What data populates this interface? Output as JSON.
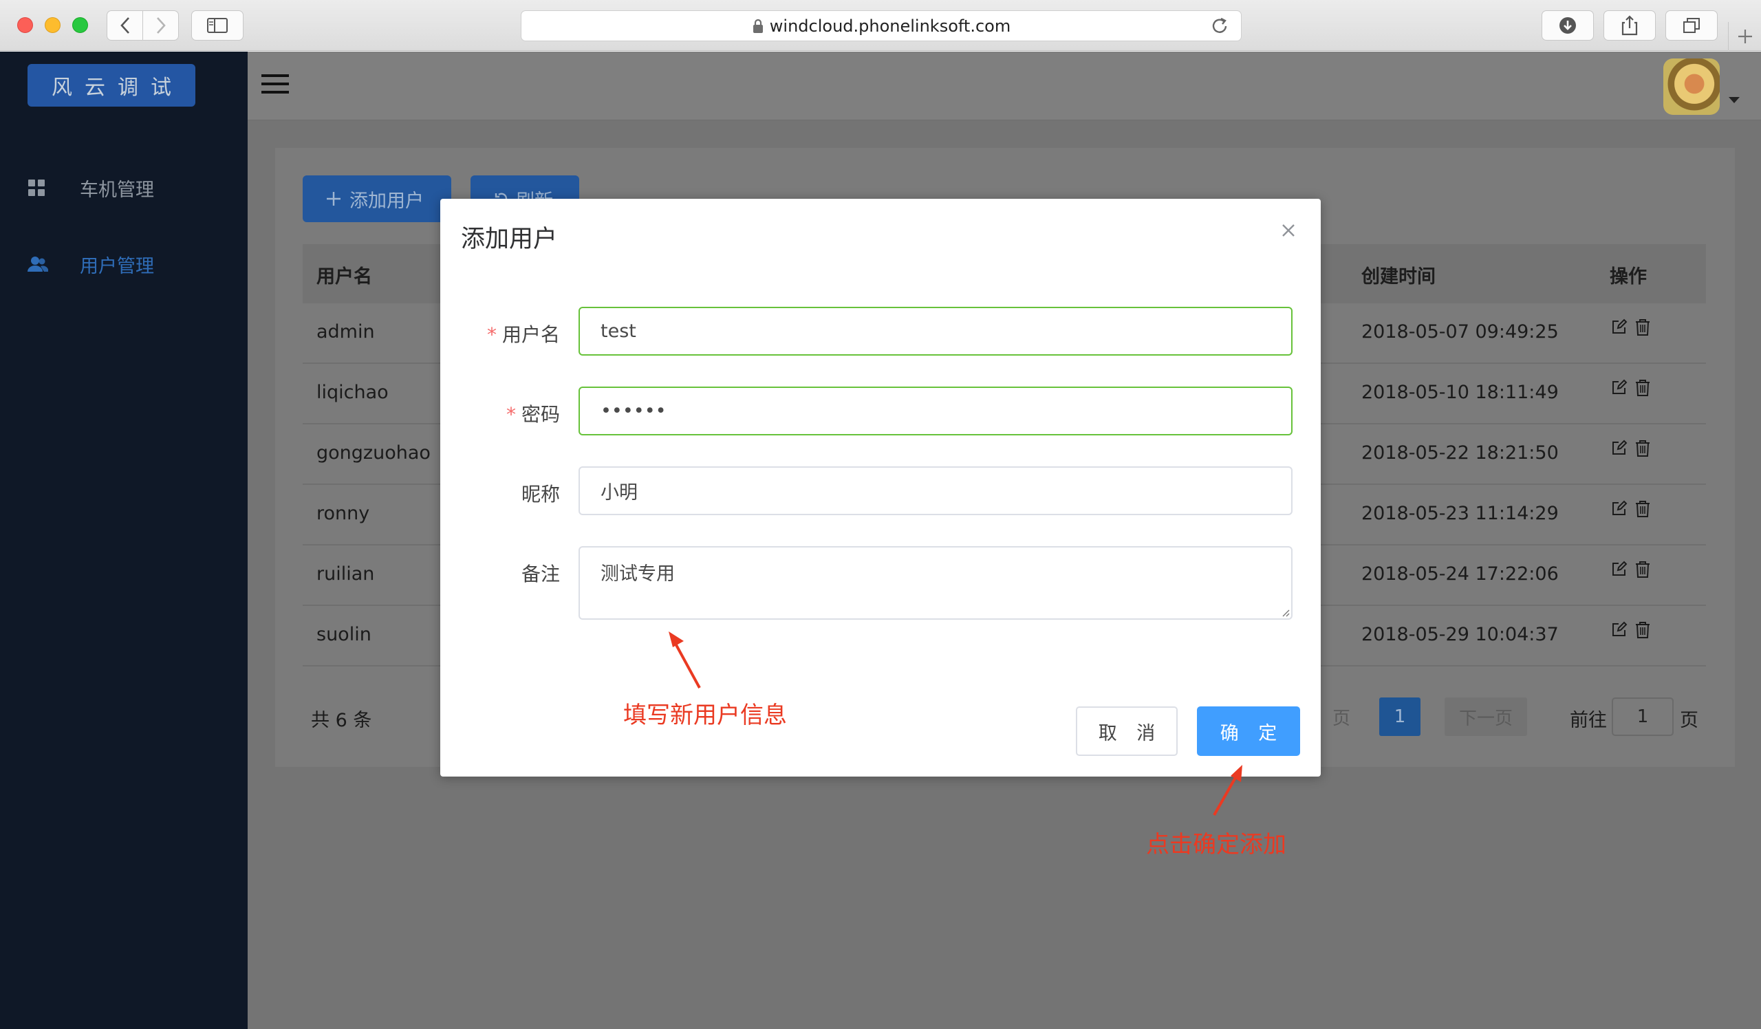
{
  "browser": {
    "url": "windcloud.phonelinksoft.com"
  },
  "sidebar": {
    "logo": "风云调试",
    "items": [
      {
        "label": "车机管理",
        "icon": "grid-icon",
        "active": false
      },
      {
        "label": "用户管理",
        "icon": "users-icon",
        "active": true
      }
    ]
  },
  "toolbar": {
    "add_user": "添加用户",
    "refresh": "刷新"
  },
  "table": {
    "columns": [
      "用户名",
      "创建时间",
      "操作"
    ],
    "rows": [
      {
        "username": "admin",
        "created": "2018-05-07 09:49:25"
      },
      {
        "username": "liqichao",
        "created": "2018-05-10 18:11:49"
      },
      {
        "username": "gongzuohao",
        "created": "2018-05-22 18:21:50"
      },
      {
        "username": "ronny",
        "created": "2018-05-23 11:14:29"
      },
      {
        "username": "ruilian",
        "created": "2018-05-24 17:22:06"
      },
      {
        "username": "suolin",
        "created": "2018-05-29 10:04:37"
      }
    ]
  },
  "pagination": {
    "total": "共 6 条",
    "prev": "页",
    "current": "1",
    "next": "下一页",
    "goto_label": "前往",
    "goto_value": "1",
    "page_suffix": "页"
  },
  "modal": {
    "title": "添加用户",
    "fields": {
      "username": {
        "label": "用户名",
        "value": "test",
        "required": true
      },
      "password": {
        "label": "密码",
        "value": "••••••",
        "required": true
      },
      "nickname": {
        "label": "昵称",
        "value": "小明",
        "required": false
      },
      "remark": {
        "label": "备注",
        "value": "测试专用",
        "required": false
      }
    },
    "cancel": "取 消",
    "confirm": "确 定"
  },
  "annotations": {
    "fill_info": "填写新用户信息",
    "click_confirm": "点击确定添加",
    "color": "#ea3a22"
  },
  "colors": {
    "primary": "#409eff",
    "success_border": "#67c23a",
    "sidebar_bg": "#0f1827",
    "required": "#f56c6c"
  }
}
